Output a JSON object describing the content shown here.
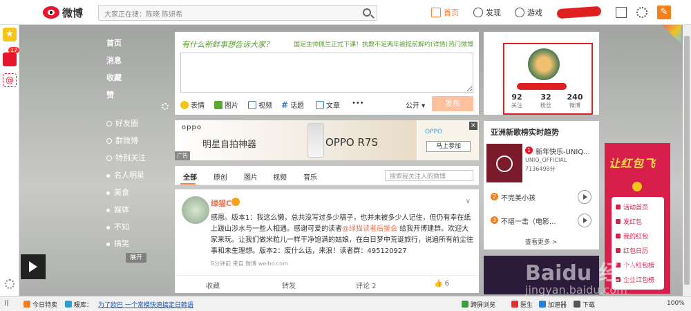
{
  "topbar": {
    "logo_text": "微博",
    "search_placeholder": "大家正在搜：陈晓 陈妍希",
    "nav_home": "首页",
    "nav_discover": "发现",
    "nav_game": "游戏"
  },
  "leftcol": {
    "badge": "17"
  },
  "leftnav": {
    "items": [
      "首页",
      "消息",
      "收藏",
      "赞"
    ],
    "groups": [
      "好友圈",
      "群微博",
      "特别关注",
      "名人明星",
      "美食",
      "媒体",
      "不知",
      "搞笑"
    ],
    "collapse": "展开"
  },
  "publish": {
    "prompt": "有什么新鲜事想告诉大家？",
    "hot_link": "国足主帅佩兰正式下课！执教不足两年被提前解约(详情)",
    "hot_weibo": "热门微博",
    "tools": [
      "表情",
      "图片",
      "视频",
      "话题",
      "文章",
      "•••"
    ],
    "visibility": "公开",
    "submit": "发布"
  },
  "ad": {
    "brand": "oppo",
    "slogan": "明星自拍神器",
    "model": "OPPO R7S",
    "tag": "广告",
    "brand2": "OPPO",
    "join": "马上参加"
  },
  "feed": {
    "tabs": [
      "全部",
      "原创",
      "图片",
      "视频",
      "音乐"
    ],
    "search_placeholder": "搜索我关注人的微博"
  },
  "post": {
    "author": "绿猫C",
    "body_1": "感恩。版本1：我这么懒，总共没写过多少稿子，也并未被多少人记住，但仍有幸在纸上跋山涉水与一些人相遇。感谢可爱的读者",
    "mention": "@绿猫读者后援会",
    "body_2": " 给我开博建群。欢迎大家来玩。让我们做米粒儿一样干净饱满的姑娘，在白日梦中荒诞旅行，说遍所有前尘往事和未生理想。版本2：废什么话，来浪！读者群：495120927",
    "meta": "8分钟前 来自 微博 weibo.com",
    "actions": [
      "收藏",
      "转发",
      "评论 2",
      "6"
    ]
  },
  "profile": {
    "stats": [
      {
        "num": "92",
        "label": "关注"
      },
      {
        "num": "32",
        "label": "粉丝"
      },
      {
        "num": "240",
        "label": "微博"
      }
    ]
  },
  "trend": {
    "title": "亚洲新歌榜实时趋势",
    "items": [
      {
        "rank": "1",
        "song": "新年快乐-UNIQ...",
        "artist": "UNIQ_OFFICIAL",
        "plays": "7136498分"
      },
      {
        "rank": "2",
        "song": "不完美小孩"
      },
      {
        "rank": "3",
        "song": "不堪一击（电影..."
      }
    ],
    "more": "查看更多 >"
  },
  "hongbao": {
    "title": "让红包飞",
    "items": [
      "活动首页",
      "发红包",
      "我的红包",
      "红包日历",
      "个人红包榜",
      "企业红包榜"
    ]
  },
  "watermark": {
    "line1": "Baidu 经验",
    "line2": "jingyan.baidu.com"
  },
  "statusbar": {
    "left": [
      "今日特卖",
      "暖库：",
      "为了欧巴 一个常模快速搞定日韩语"
    ],
    "right": [
      "跨屏浏览",
      "医生",
      "加速器",
      "下载",
      "100%"
    ]
  }
}
